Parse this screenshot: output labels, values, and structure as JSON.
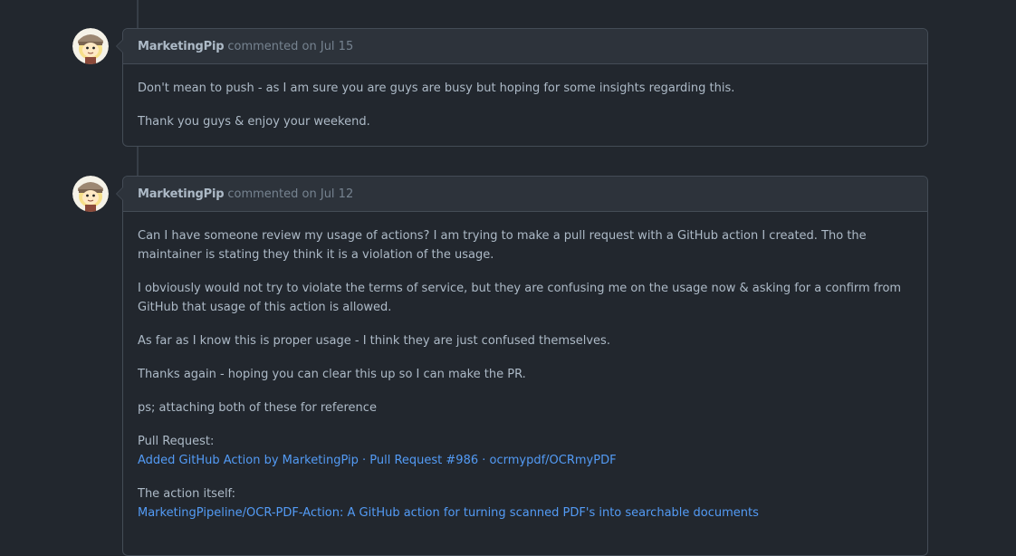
{
  "comments": [
    {
      "author": "MarketingPip",
      "action": "commented",
      "on": "on",
      "date": "Jul 15",
      "avatar_icon": "cartoon-avatar",
      "paragraphs": [
        "Don't mean to push - as I am sure you are guys are busy but hoping for some insights regarding this.",
        "Thank you guys & enjoy your weekend."
      ]
    },
    {
      "author": "MarketingPip",
      "action": "commented",
      "on": "on",
      "date": "Jul 12",
      "avatar_icon": "cartoon-avatar",
      "paragraphs": [
        "Can I have someone review my usage of actions? I am trying to make a pull request with a GitHub action I created. Tho the maintainer is stating they think it is a violation of the usage.",
        "I obviously would not try to violate the terms of service, but they are confusing me on the usage now & asking for a confirm from GitHub that usage of this action is allowed.",
        "As far as I know this is proper usage - I think they are just confused themselves.",
        "Thanks again - hoping you can clear this up so I can make the PR.",
        "ps; attaching both of these for reference"
      ],
      "pr_label": "Pull Request:",
      "pr_link": "Added GitHub Action by MarketingPip · Pull Request #986 · ocrmypdf/OCRmyPDF",
      "action_label": "The action itself:",
      "action_link": "MarketingPipeline/OCR-PDF-Action: A GitHub action for turning scanned PDF's into searchable documents"
    }
  ],
  "colors": {
    "background": "#22272e",
    "header_bg": "#2d333b",
    "border": "#444c56",
    "text": "#adbac7",
    "muted": "#768390",
    "link": "#539bf5"
  }
}
